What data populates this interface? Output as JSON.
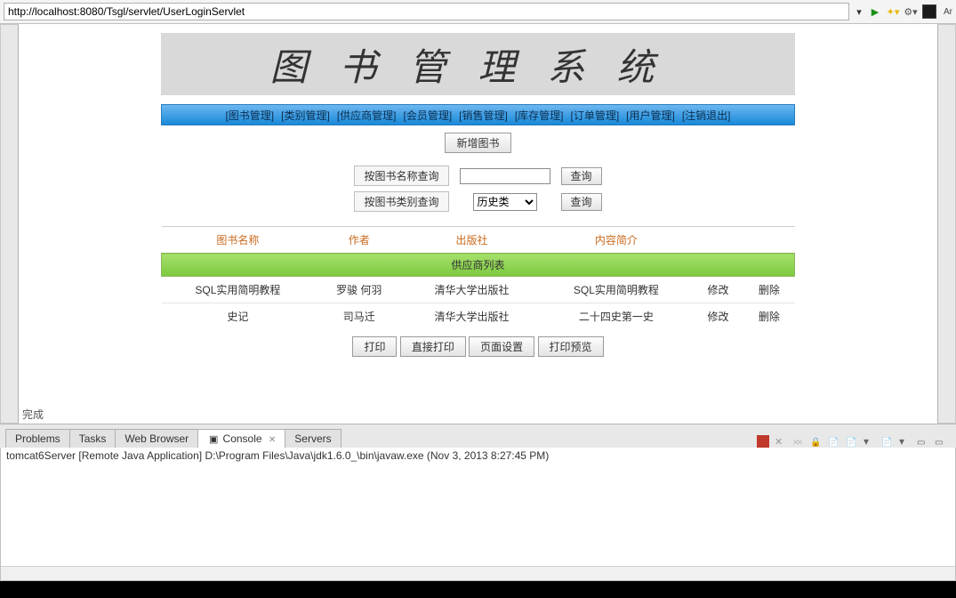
{
  "urlbar": {
    "url": "http://localhost:8080/Tsgl/servlet/UserLoginServlet"
  },
  "right_label": "Ar",
  "page": {
    "title": "图书管理系统",
    "nav": [
      "[图书管理]",
      "[类别管理]",
      "[供应商管理]",
      "[会员管理]",
      "[销售管理]",
      "[库存管理]",
      "[订单管理]",
      "[用户管理]",
      "[注销退出]"
    ],
    "add_btn": "新增图书",
    "search": {
      "by_name_label": "按图书名称查询",
      "by_cat_label": "按图书类别查询",
      "name_value": "",
      "cat_value": "历史类",
      "query_btn": "查询"
    },
    "table": {
      "caption": "供应商列表",
      "headers": [
        "图书名称",
        "作者",
        "出版社",
        "内容简介"
      ],
      "rows": [
        {
          "name": "SQL实用简明教程",
          "author": "罗骏 何羽",
          "press": "清华大学出版社",
          "intro": "SQL实用简明教程",
          "edit": "修改",
          "del": "删除"
        },
        {
          "name": "史记",
          "author": "司马迁",
          "press": "清华大学出版社",
          "intro": "二十四史第一史",
          "edit": "修改",
          "del": "删除"
        }
      ]
    },
    "print_btns": [
      "打印",
      "直接打印",
      "页面设置",
      "打印预览"
    ],
    "status": "完成"
  },
  "tabs": {
    "items": [
      "Problems",
      "Tasks",
      "Web Browser",
      "Console",
      "Servers"
    ],
    "active": "Console"
  },
  "console": {
    "line": "tomcat6Server [Remote Java Application] D:\\Program Files\\Java\\jdk1.6.0_\\bin\\javaw.exe (Nov 3, 2013 8:27:45 PM)"
  }
}
